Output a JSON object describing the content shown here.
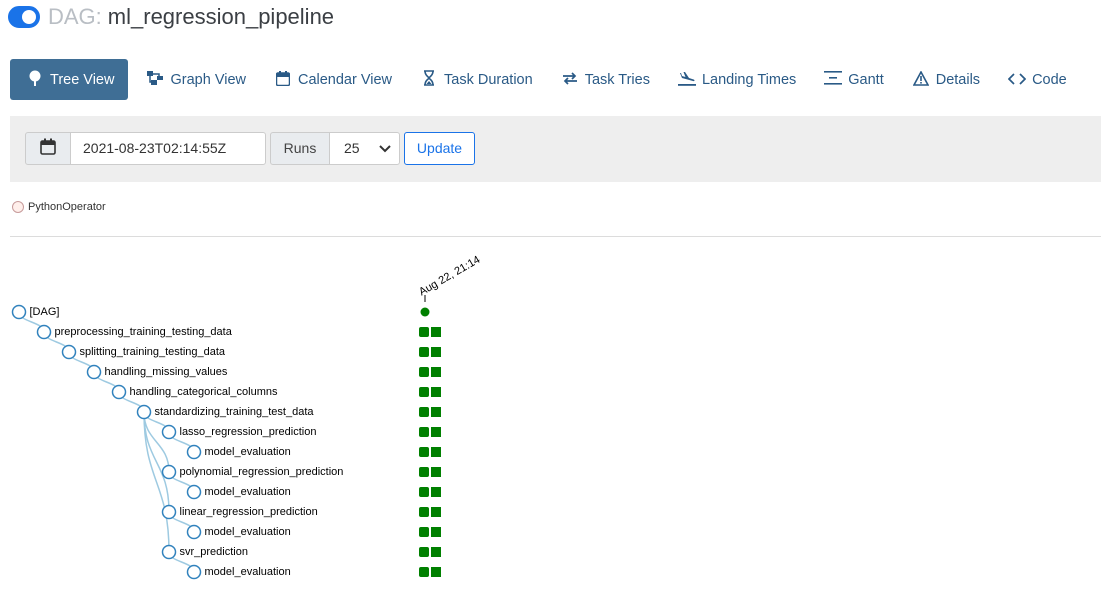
{
  "header": {
    "prefix": "DAG:",
    "dag_id": "ml_regression_pipeline",
    "toggle_on": true
  },
  "nav": {
    "tabs": [
      {
        "label": "Tree View",
        "icon": "tree-icon",
        "active": true
      },
      {
        "label": "Graph View",
        "icon": "graph-icon"
      },
      {
        "label": "Calendar View",
        "icon": "calendar-icon"
      },
      {
        "label": "Task Duration",
        "icon": "hourglass-icon"
      },
      {
        "label": "Task Tries",
        "icon": "retry-icon"
      },
      {
        "label": "Landing Times",
        "icon": "plane-landing-icon"
      },
      {
        "label": "Gantt",
        "icon": "gantt-icon"
      },
      {
        "label": "Details",
        "icon": "warning-icon"
      },
      {
        "label": "Code",
        "icon": "code-icon"
      }
    ]
  },
  "controls": {
    "base_date": "2021-08-23T02:14:55Z",
    "runs_label": "Runs",
    "runs_value": "25",
    "update_label": "Update"
  },
  "legend": {
    "items": [
      {
        "label": "PythonOperator",
        "color": "#ffefeb"
      }
    ]
  },
  "tree": {
    "run_date": "Aug 22, 21:14",
    "status_color": "#008000",
    "nodes": [
      {
        "label": "[DAG]",
        "depth": 0,
        "parent": -1,
        "dag_run": true
      },
      {
        "label": "preprocessing_training_testing_data",
        "depth": 1,
        "parent": 0
      },
      {
        "label": "splitting_training_testing_data",
        "depth": 2,
        "parent": 1
      },
      {
        "label": "handling_missing_values",
        "depth": 3,
        "parent": 2
      },
      {
        "label": "handling_categorical_columns",
        "depth": 4,
        "parent": 3
      },
      {
        "label": "standardizing_training_test_data",
        "depth": 5,
        "parent": 4
      },
      {
        "label": "lasso_regression_prediction",
        "depth": 6,
        "parent": 5
      },
      {
        "label": "model_evaluation",
        "depth": 7,
        "parent": 6
      },
      {
        "label": "polynomial_regression_prediction",
        "depth": 6,
        "parent": 5
      },
      {
        "label": "model_evaluation",
        "depth": 7,
        "parent": 8
      },
      {
        "label": "linear_regression_prediction",
        "depth": 6,
        "parent": 5
      },
      {
        "label": "model_evaluation",
        "depth": 7,
        "parent": 10
      },
      {
        "label": "svr_prediction",
        "depth": 6,
        "parent": 5
      },
      {
        "label": "model_evaluation",
        "depth": 7,
        "parent": 12
      }
    ]
  }
}
